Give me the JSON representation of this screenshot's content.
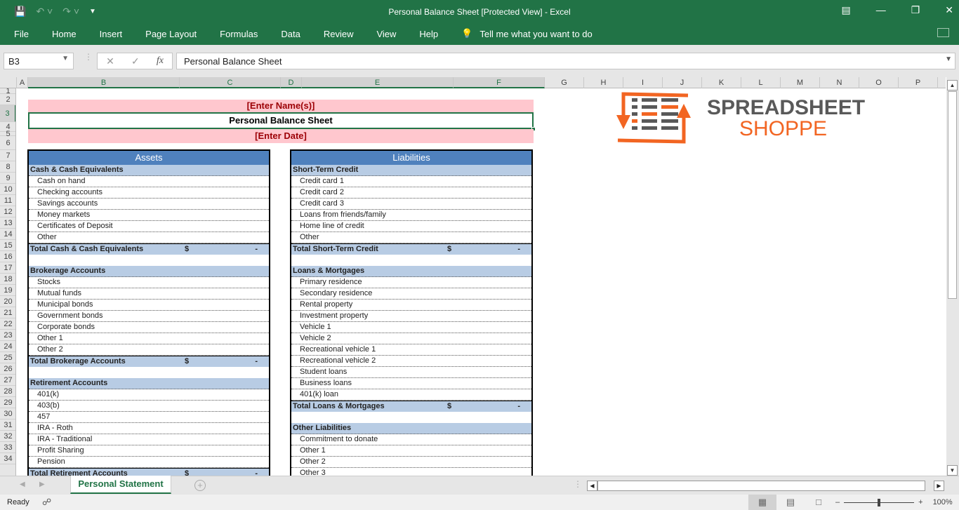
{
  "window": {
    "title": "Personal Balance Sheet  [Protected View]  -  Excel",
    "controls": [
      "ribbon-display-icon",
      "minimize-icon",
      "restore-icon",
      "close-icon"
    ]
  },
  "qat": {
    "save": "save-icon",
    "undo": "undo-icon",
    "redo": "redo-icon",
    "customize": "customize-icon"
  },
  "ribbon": {
    "tabs": [
      "File",
      "Home",
      "Insert",
      "Page Layout",
      "Formulas",
      "Data",
      "Review",
      "View",
      "Help"
    ],
    "tell_me": "Tell me what you want to do"
  },
  "formula_bar": {
    "name_box": "B3",
    "content": "Personal Balance Sheet",
    "fx": "fx"
  },
  "columns": [
    "A",
    "B",
    "C",
    "D",
    "E",
    "F",
    "G",
    "H",
    "I",
    "J",
    "K",
    "L",
    "M",
    "N",
    "O",
    "P"
  ],
  "rows": [
    "1",
    "2",
    "3",
    "4",
    "5",
    "6",
    "7",
    "8",
    "9",
    "10",
    "11",
    "12",
    "13",
    "14",
    "15",
    "16",
    "17",
    "18",
    "19",
    "20",
    "21",
    "22",
    "23",
    "24",
    "25",
    "26",
    "27",
    "28",
    "29",
    "30",
    "31",
    "32",
    "33",
    "34"
  ],
  "sheet": {
    "name_placeholder": "[Enter Name(s)]",
    "title": "Personal Balance Sheet",
    "date_placeholder": "[Enter Date]",
    "assets": {
      "header": "Assets",
      "rows": [
        {
          "type": "sec",
          "label": "Cash & Cash Equivalents"
        },
        {
          "type": "item",
          "label": "Cash on hand"
        },
        {
          "type": "item",
          "label": "Checking accounts"
        },
        {
          "type": "item",
          "label": "Savings accounts"
        },
        {
          "type": "item",
          "label": "Money markets"
        },
        {
          "type": "item",
          "label": "Certificates of Deposit"
        },
        {
          "type": "item",
          "label": "Other"
        },
        {
          "type": "tot",
          "label": "Total Cash & Cash Equivalents",
          "currency": "$",
          "value": "-"
        },
        {
          "type": "blank",
          "label": ""
        },
        {
          "type": "sec",
          "label": "Brokerage Accounts"
        },
        {
          "type": "item",
          "label": "Stocks"
        },
        {
          "type": "item",
          "label": "Mutual funds"
        },
        {
          "type": "item",
          "label": "Municipal bonds"
        },
        {
          "type": "item",
          "label": "Government bonds"
        },
        {
          "type": "item",
          "label": "Corporate bonds"
        },
        {
          "type": "item",
          "label": "Other 1"
        },
        {
          "type": "item",
          "label": "Other 2"
        },
        {
          "type": "tot",
          "label": "Total Brokerage Accounts",
          "currency": "$",
          "value": "-"
        },
        {
          "type": "blank",
          "label": ""
        },
        {
          "type": "sec",
          "label": "Retirement Accounts"
        },
        {
          "type": "item",
          "label": "401(k)"
        },
        {
          "type": "item",
          "label": "403(b)"
        },
        {
          "type": "item",
          "label": "457"
        },
        {
          "type": "item",
          "label": "IRA - Roth"
        },
        {
          "type": "item",
          "label": "IRA - Traditional"
        },
        {
          "type": "item",
          "label": "Profit Sharing"
        },
        {
          "type": "item",
          "label": "Pension"
        },
        {
          "type": "tot",
          "label": "Total Retirement Accounts",
          "currency": "$",
          "value": "-"
        }
      ]
    },
    "liabilities": {
      "header": "Liabilities",
      "rows": [
        {
          "type": "sec",
          "label": "Short-Term Credit"
        },
        {
          "type": "item",
          "label": "Credit card 1"
        },
        {
          "type": "item",
          "label": "Credit card 2"
        },
        {
          "type": "item",
          "label": "Credit card 3"
        },
        {
          "type": "item",
          "label": "Loans from friends/family"
        },
        {
          "type": "item",
          "label": "Home line of credit"
        },
        {
          "type": "item",
          "label": "Other"
        },
        {
          "type": "tot",
          "label": "Total Short-Term Credit",
          "currency": "$",
          "value": "-"
        },
        {
          "type": "blank",
          "label": ""
        },
        {
          "type": "sec",
          "label": "Loans & Mortgages"
        },
        {
          "type": "item",
          "label": "Primary  residence"
        },
        {
          "type": "item",
          "label": "Secondary residence"
        },
        {
          "type": "item",
          "label": "Rental property"
        },
        {
          "type": "item",
          "label": "Investment property"
        },
        {
          "type": "item",
          "label": "Vehicle 1"
        },
        {
          "type": "item",
          "label": "Vehicle 2"
        },
        {
          "type": "item",
          "label": "Recreational vehicle 1"
        },
        {
          "type": "item",
          "label": "Recreational vehicle 2"
        },
        {
          "type": "item",
          "label": "Student loans"
        },
        {
          "type": "item",
          "label": "Business loans"
        },
        {
          "type": "item",
          "label": "401(k) loan"
        },
        {
          "type": "tot",
          "label": "Total Loans & Mortgages",
          "currency": "$",
          "value": "-"
        },
        {
          "type": "blank",
          "label": ""
        },
        {
          "type": "sec",
          "label": "Other Liabilities"
        },
        {
          "type": "item",
          "label": "Commitment to donate"
        },
        {
          "type": "item",
          "label": "Other 1"
        },
        {
          "type": "item",
          "label": "Other 2"
        },
        {
          "type": "item",
          "label": "Other 3"
        }
      ]
    },
    "logo": {
      "line1": "SPREADSHEET",
      "line2": "SHOPPE",
      "accent": "#f26522",
      "gray": "#595959"
    }
  },
  "sheet_tabs": {
    "active": "Personal Statement"
  },
  "status": {
    "mode": "Ready",
    "zoom": "100%",
    "zoom_level_pct": 100
  }
}
